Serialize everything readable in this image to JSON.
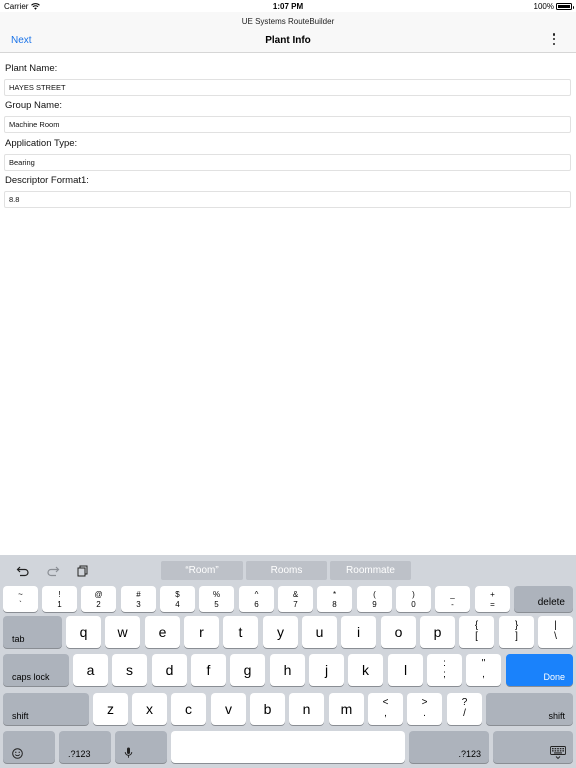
{
  "status": {
    "carrier": "Carrier",
    "time": "1:07 PM",
    "battery": "100%",
    "battery_level": 1.0
  },
  "nav": {
    "app_title": "UE Systems RouteBuilder",
    "next": "Next",
    "title": "Plant Info",
    "more_icon": "vertical-ellipsis-icon"
  },
  "form": {
    "fields": [
      {
        "label": "Plant Name:",
        "value": "HAYES STREET"
      },
      {
        "label": "Group Name:",
        "value": "Machine Room"
      },
      {
        "label": "Application Type:",
        "value": "Bearing"
      },
      {
        "label": "Descriptor Format1:",
        "value": "8.8"
      }
    ]
  },
  "keyboard": {
    "toolbar": {
      "undo_icon": "undo-icon",
      "redo_icon": "redo-icon",
      "paste_icon": "paste-icon"
    },
    "suggestions": [
      "“Room”",
      "Rooms",
      "Roommate"
    ],
    "row1": [
      [
        "~",
        "`"
      ],
      [
        "!",
        "1"
      ],
      [
        "@",
        "2"
      ],
      [
        "#",
        "3"
      ],
      [
        "$",
        "4"
      ],
      [
        "%",
        "5"
      ],
      [
        "^",
        "6"
      ],
      [
        "&",
        "7"
      ],
      [
        "*",
        "8"
      ],
      [
        "(",
        "9"
      ],
      [
        ")",
        "0"
      ],
      [
        "_",
        "-"
      ],
      [
        "+",
        "="
      ]
    ],
    "delete": "delete",
    "tab": "tab",
    "row2": [
      "q",
      "w",
      "e",
      "r",
      "t",
      "y",
      "u",
      "i",
      "o",
      "p"
    ],
    "row2_sym": [
      [
        "{",
        "["
      ],
      [
        "}",
        "]"
      ],
      [
        "|",
        "\\"
      ]
    ],
    "caps_lock": "caps lock",
    "row3": [
      "a",
      "s",
      "d",
      "f",
      "g",
      "h",
      "j",
      "k",
      "l"
    ],
    "row3_sym": [
      [
        ":",
        ";"
      ],
      [
        "\"",
        ","
      ]
    ],
    "done": "Done",
    "shift": "shift",
    "row4": [
      "z",
      "x",
      "c",
      "v",
      "b",
      "n",
      "m"
    ],
    "row4_sym": [
      [
        "<",
        ","
      ],
      [
        ">",
        "."
      ],
      [
        "?",
        "/"
      ]
    ],
    "numbers": ".?123",
    "emoji_icon": "emoji-icon",
    "mic_icon": "microphone-icon",
    "hide_keyboard_icon": "hide-keyboard-icon",
    "accent_color": "#1a82fb"
  }
}
